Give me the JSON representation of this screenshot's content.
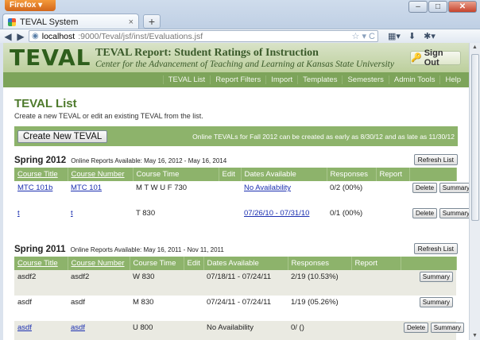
{
  "browser": {
    "menu_label": "Firefox",
    "tab_title": "TEVAL System",
    "new_tab": "+",
    "url_host": "localhost",
    "url_path": ":9000/Teval/jsf/inst/Evaluations.jsf",
    "win_min": "–",
    "win_max": "□",
    "win_close": "✕"
  },
  "header": {
    "logo": "TEVAL",
    "title": "TEVAL Report: Student Ratings of Instruction",
    "subtitle": "Center for the Advancement of Teaching and Learning at Kansas State University",
    "sign_out": "Sign Out"
  },
  "menu": [
    "TEVAL List",
    "Report Filters",
    "Import",
    "Templates",
    "Semesters",
    "Admin Tools",
    "Help"
  ],
  "main": {
    "heading": "TEVAL List",
    "description": "Create a new TEVAL or edit an existing TEVAL from the list.",
    "create_button": "Create New TEVAL",
    "notice": "Online TEVALs for Fall 2012 can be created as early as 8/30/12 and as late as 11/30/12"
  },
  "columns": [
    "Course Title",
    "Course Number",
    "Course Time",
    "Edit",
    "Dates Available",
    "Responses",
    "Report",
    ""
  ],
  "semesters": [
    {
      "name": "Spring 2012",
      "availability": "Online Reports Available: May 16, 2012 - May 16, 2014",
      "refresh": "Refresh List",
      "rows": [
        {
          "title": "MTC 101b",
          "number": "MTC 101",
          "time": "M T W U F 730",
          "dates": "No Availability",
          "responses": "0/2 (00%)"
        },
        {
          "title": "t",
          "number": "t",
          "time": "T 830",
          "dates": "07/26/10 - 07/31/10",
          "responses": "0/1 (00%)"
        }
      ]
    },
    {
      "name": "Spring 2011",
      "availability": "Online Reports Available: May 16, 2011 - Nov 11, 2011",
      "refresh": "Refresh List",
      "rows": [
        {
          "title": "asdf2",
          "number": "asdf2",
          "time": "W 830",
          "dates": "07/18/11 - 07/24/11",
          "responses": "2/19 (10.53%)"
        },
        {
          "title": "asdf",
          "number": "asdf",
          "time": "M 830",
          "dates": "07/24/11 - 07/24/11",
          "responses": "1/19 (05.26%)"
        },
        {
          "title": "asdf",
          "number": "asdf",
          "time": "U 800",
          "dates": "No Availability",
          "responses": "0/ ()"
        }
      ]
    }
  ],
  "actions": {
    "delete": "Delete",
    "summary": "Summary"
  }
}
